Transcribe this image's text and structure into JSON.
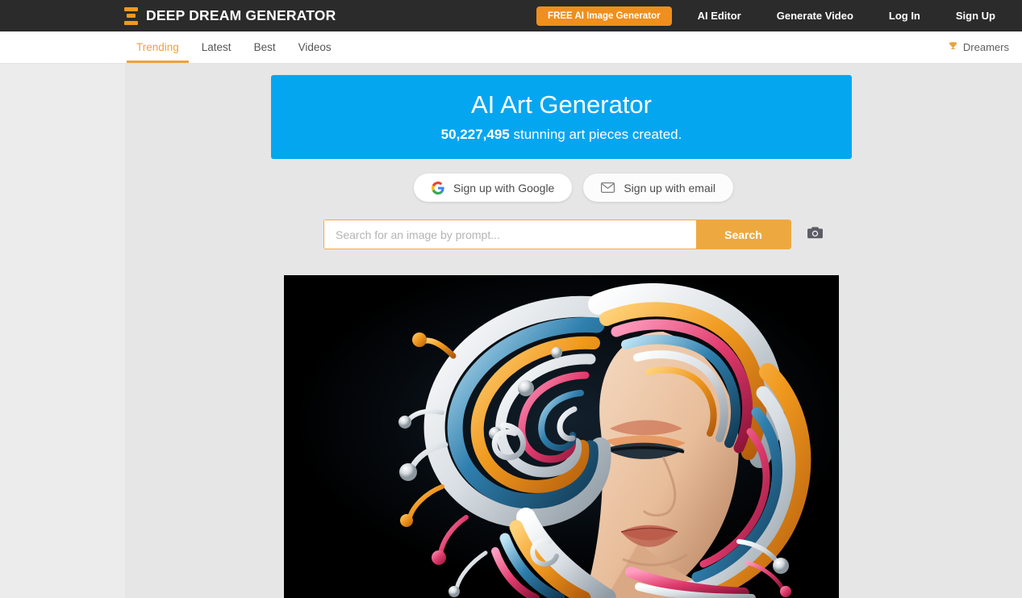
{
  "header": {
    "logo_icon": "stacked-bars-logo-icon",
    "brand": "DEEP DREAM GENERATOR",
    "cta": "FREE AI Image Generator",
    "links": [
      {
        "label": "AI Editor"
      },
      {
        "label": "Generate Video"
      },
      {
        "label": "Log In"
      },
      {
        "label": "Sign Up"
      }
    ],
    "colors": {
      "bar_bg": "#2b2b2b",
      "accent_orange": "#ee8f1e",
      "text": "#ffffff"
    }
  },
  "subnav": {
    "tabs": [
      {
        "label": "Trending",
        "active": true
      },
      {
        "label": "Latest",
        "active": false
      },
      {
        "label": "Best",
        "active": false
      },
      {
        "label": "Videos",
        "active": false
      }
    ],
    "dreamers": {
      "icon": "trophy-icon",
      "label": "Dreamers"
    },
    "active_color": "#f0a13c"
  },
  "hero": {
    "title": "AI Art Generator",
    "count": "50,227,495",
    "subtitle_suffix": " stunning art pieces created.",
    "bg_color": "#05a6f0"
  },
  "signup": {
    "google": {
      "icon": "google-g-icon",
      "label": "Sign up with Google"
    },
    "email": {
      "icon": "envelope-icon",
      "label": "Sign up with email"
    }
  },
  "search": {
    "placeholder": "Search for an image by prompt...",
    "value": "",
    "button_label": "Search",
    "camera_icon": "camera-icon",
    "button_color": "#eda93f",
    "border_color": "#f0a94a"
  },
  "artwork": {
    "alt": "AI generated portrait of a woman with flowing multicolored swirling hair",
    "bg_color": "#000000"
  }
}
